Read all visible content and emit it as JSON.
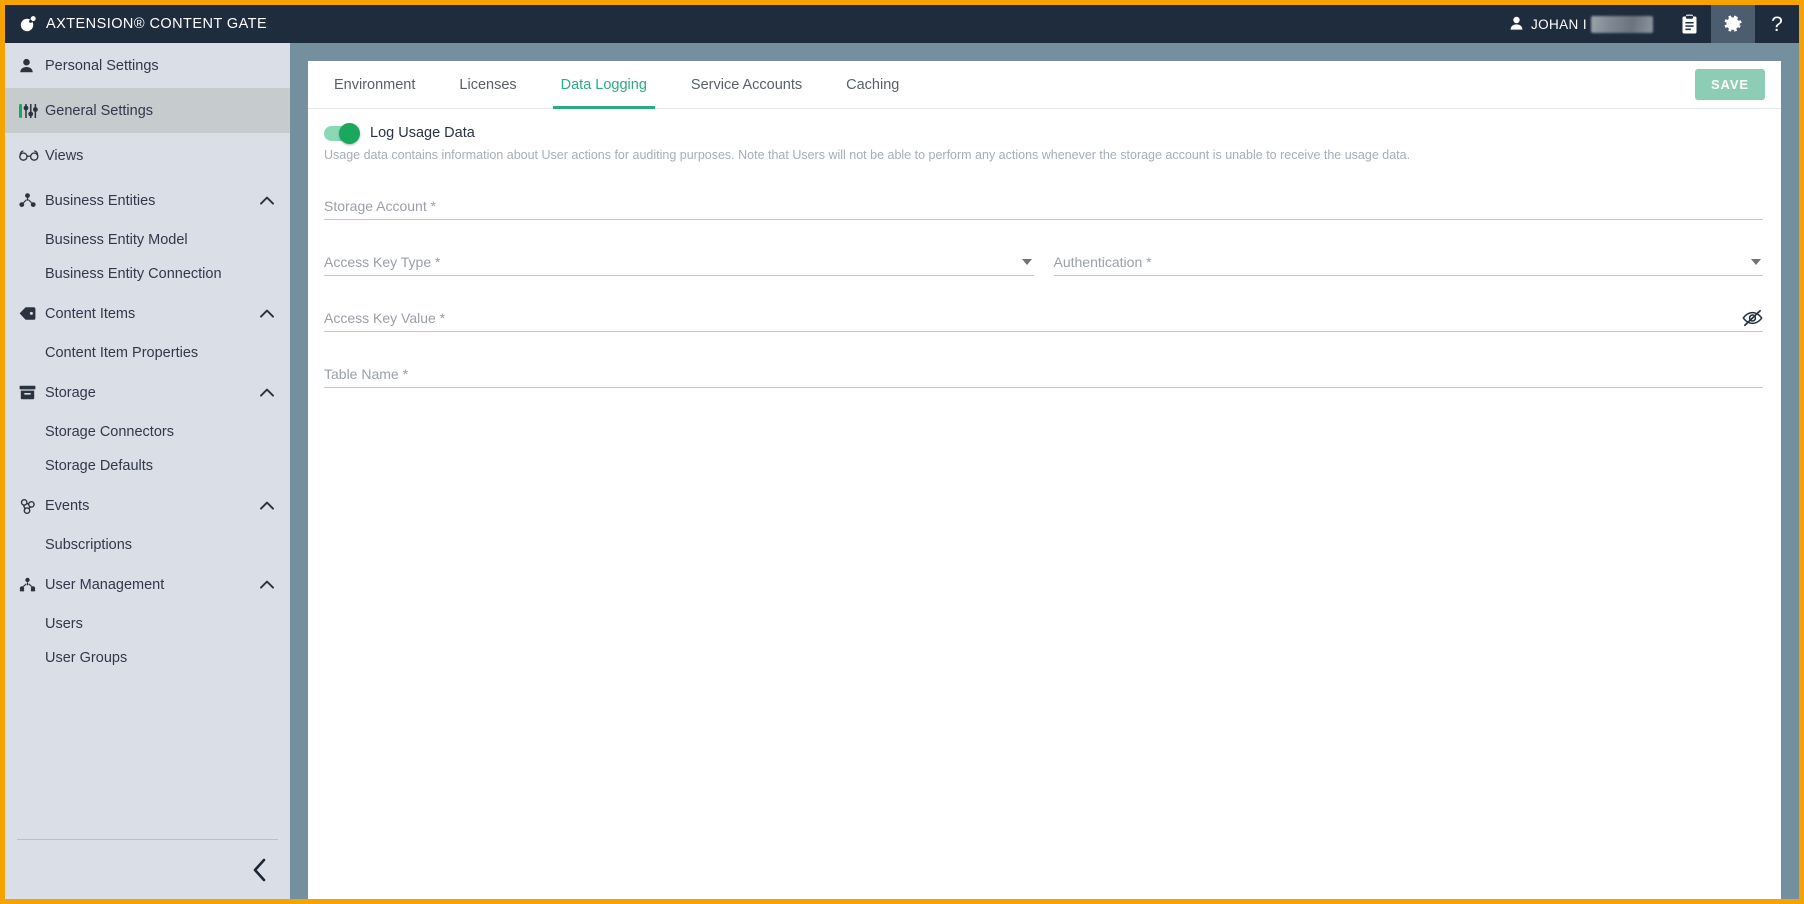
{
  "app": {
    "title": "AXTENSION® CONTENT GATE",
    "logo_icon": "axtension-logo-icon",
    "accent_color": "#2bab7f",
    "header_bg": "#1f2c3e",
    "frame_color": "#f5a300",
    "canvas_color": "#74909f",
    "sidebar_color": "#dadfe7"
  },
  "header": {
    "user": {
      "icon": "user-icon",
      "name": "JOHAN I",
      "redacted": true
    },
    "buttons": [
      {
        "icon": "clipboard-icon",
        "label": "",
        "active": false
      },
      {
        "icon": "gear-icon",
        "label": "",
        "active": true
      },
      {
        "icon": "help-icon",
        "label": "?",
        "active": false
      }
    ]
  },
  "sidebar": {
    "items": [
      {
        "label": "Personal Settings",
        "icon": "person-icon",
        "selected": false,
        "expandable": false,
        "children": []
      },
      {
        "label": "General Settings",
        "icon": "sliders-icon",
        "selected": true,
        "expandable": false,
        "children": []
      },
      {
        "label": "Views",
        "icon": "glasses-icon",
        "selected": false,
        "expandable": false,
        "children": []
      },
      {
        "label": "Business Entities",
        "icon": "hierarchy-icon",
        "selected": false,
        "expandable": true,
        "expanded": true,
        "children": [
          "Business Entity Model",
          "Business Entity Connection"
        ]
      },
      {
        "label": "Content Items",
        "icon": "tag-icon",
        "selected": false,
        "expandable": true,
        "expanded": true,
        "children": [
          "Content Item Properties"
        ]
      },
      {
        "label": "Storage",
        "icon": "archive-icon",
        "selected": false,
        "expandable": true,
        "expanded": true,
        "children": [
          "Storage Connectors",
          "Storage Defaults"
        ]
      },
      {
        "label": "Events",
        "icon": "webhook-icon",
        "selected": false,
        "expandable": true,
        "expanded": true,
        "children": [
          "Subscriptions"
        ]
      },
      {
        "label": "User Management",
        "icon": "org-chart-icon",
        "selected": false,
        "expandable": true,
        "expanded": true,
        "children": [
          "Users",
          "User Groups"
        ]
      }
    ],
    "collapse_icon": "chevron-left-icon",
    "chevron_icon": "chevron-up-icon"
  },
  "main": {
    "tabs": [
      {
        "label": "Environment",
        "active": false
      },
      {
        "label": "Licenses",
        "active": false
      },
      {
        "label": "Data Logging",
        "active": true
      },
      {
        "label": "Service Accounts",
        "active": false
      },
      {
        "label": "Caching",
        "active": false
      }
    ],
    "save_label": "SAVE",
    "toggle": {
      "label": "Log Usage Data",
      "on": true
    },
    "helper_text": "Usage data contains information about User actions for auditing purposes. Note that Users will not be able to perform any actions whenever the storage account is unable to receive the usage data.",
    "fields": {
      "storage_account": {
        "label": "Storage Account",
        "required_mark": "*",
        "value": "",
        "type": "text"
      },
      "access_key_type": {
        "label": "Access Key Type",
        "required_mark": "*",
        "value": "",
        "type": "select",
        "icon": "chevron-down-icon"
      },
      "authentication": {
        "label": "Authentication",
        "required_mark": "*",
        "value": "",
        "type": "select",
        "icon": "chevron-down-icon"
      },
      "access_key_value": {
        "label": "Access Key Value",
        "required_mark": "*",
        "value": "",
        "type": "password",
        "icon": "eye-off-icon"
      },
      "table_name": {
        "label": "Table Name",
        "required_mark": "*",
        "value": "",
        "type": "text"
      }
    }
  }
}
